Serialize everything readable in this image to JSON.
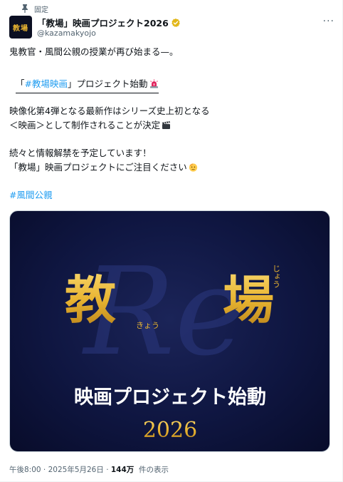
{
  "pinned_label": "固定",
  "account": {
    "avatar_text": "教場",
    "name": "「教場」映画プロジェクト2026",
    "handle": "@kazamakyojo"
  },
  "post": {
    "line1": "鬼教官・風間公親の授業が再び始まる—。",
    "line2_open": "「",
    "line2_hashtag": "#教場映画",
    "line2_close": "」プロジェクト始動",
    "line3": "映像化第4弾となる最新作はシリーズ史上初となる",
    "line4": "＜映画＞として制作されることが決定",
    "line5": "続々と情報解禁を予定しています！",
    "line6": "「教場」映画プロジェクトにご注目ください",
    "hashtag": "#風間公親"
  },
  "media": {
    "kanji_left": "教",
    "kanji_right": "場",
    "ruby_left": "きょう",
    "ruby_right": "じょう",
    "bg_letters": "Re",
    "subtitle": "映画プロジェクト始動",
    "year": "2026"
  },
  "meta": {
    "timestamp": "午後8:00 · 2025年5月26日 · ",
    "views_count": "144万",
    "views_label": "件の表示"
  },
  "colors": {
    "accent": "#1d9bf0",
    "gold": "#e8b431",
    "navy": "#0f1641"
  }
}
